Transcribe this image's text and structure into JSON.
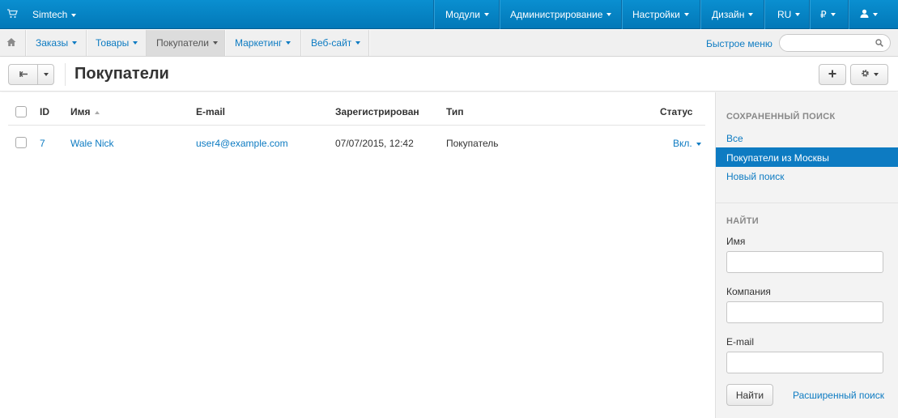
{
  "topbar": {
    "brand": "Simtech",
    "menu": [
      "Модули",
      "Администрирование",
      "Настройки",
      "Дизайн"
    ],
    "language": "RU",
    "currency": "₽"
  },
  "subnav": {
    "items": [
      "Заказы",
      "Товары",
      "Покупатели",
      "Маркетинг",
      "Веб-сайт"
    ],
    "quick_menu": "Быстрое меню",
    "search_placeholder": ""
  },
  "page": {
    "title": "Покупатели"
  },
  "table": {
    "columns": [
      "ID",
      "Имя",
      "E-mail",
      "Зарегистрирован",
      "Тип",
      "Статус"
    ],
    "rows": [
      {
        "id": "7",
        "name": "Wale Nick",
        "email": "user4@example.com",
        "registered": "07/07/2015, 12:42",
        "type": "Покупатель",
        "status": "Вкл."
      }
    ]
  },
  "sidebar": {
    "saved_search_heading": "СОХРАНЕННЫЙ ПОИСК",
    "saved_searches": [
      "Все",
      "Покупатели из Москвы",
      "Новый поиск"
    ],
    "find_heading": "НАЙТИ",
    "fields": [
      "Имя",
      "Компания",
      "E-mail"
    ],
    "find_button": "Найти",
    "advanced_search": "Расширенный поиск"
  },
  "colors": {
    "accent": "#0d7bc2",
    "topbar": "#0483c4"
  }
}
